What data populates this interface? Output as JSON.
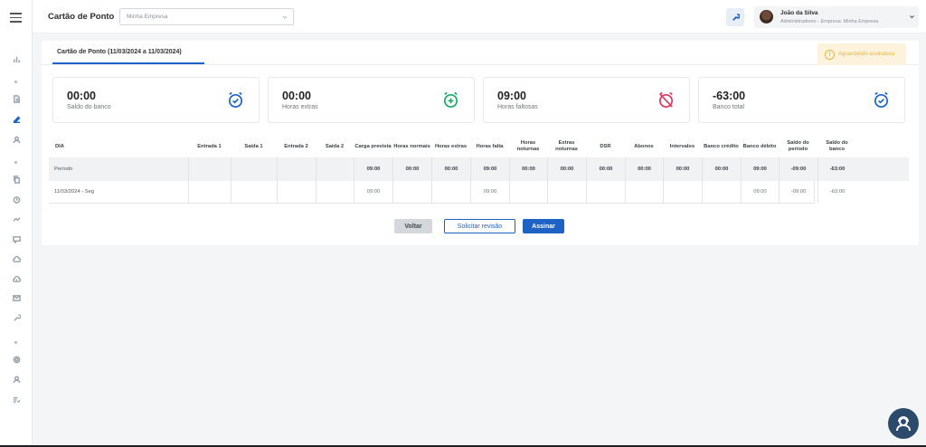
{
  "header": {
    "title": "Cartão de Ponto",
    "company_select": "Minha Empresa",
    "user_name": "João da Silva",
    "user_role": "Administradores - Empresa: Minha Empresa"
  },
  "tab": {
    "label": "Cartão de Ponto (11/03/2024 a 11/03/2024)"
  },
  "status": {
    "label": "Aguardando assinatura"
  },
  "summary": [
    {
      "value": "00:00",
      "label": "Saldo do banco",
      "icon": "alarm-check-icon",
      "color": "#1e62c8"
    },
    {
      "value": "00:00",
      "label": "Horas extras",
      "icon": "alarm-plus-icon",
      "color": "#1fa66a"
    },
    {
      "value": "09:00",
      "label": "Horas faltosas",
      "icon": "alarm-off-icon",
      "color": "#e0365a"
    },
    {
      "value": "-63:00",
      "label": "Banco total",
      "icon": "alarm-check-icon",
      "color": "#1e62c8"
    }
  ],
  "table": {
    "headers": [
      "DIA",
      "Entrada 1",
      "Saída 1",
      "Entrada 2",
      "Saída 2",
      "Carga prevista",
      "Horas normais",
      "Horas extras",
      "Horas falta",
      "Horas noturnas",
      "Extras noturnas",
      "DSR",
      "Abonos",
      "Intervalos",
      "Banco crédito",
      "Banco débito",
      "Saldo do período",
      "Saldo do banco"
    ],
    "periodo": [
      "Período",
      "",
      "",
      "",
      "",
      "09:00",
      "00:00",
      "00:00",
      "09:00",
      "00:00",
      "00:00",
      "00:00",
      "00:00",
      "00:00",
      "00:00",
      "09:00",
      "-09:00",
      "-63:00"
    ],
    "rows": [
      [
        "11/03/2024 - Seg",
        "",
        "",
        "",
        "",
        "09:00",
        "",
        "",
        "09:00",
        "",
        "",
        "",
        "",
        "",
        "",
        "09:00",
        "-09:00",
        "-63:00"
      ]
    ]
  },
  "buttons": {
    "voltar": "Voltar",
    "revisao": "Solicitar revisão",
    "assinar": "Assinar"
  },
  "colors": {
    "accent": "#1e62c8",
    "warning": "#e8b640"
  }
}
